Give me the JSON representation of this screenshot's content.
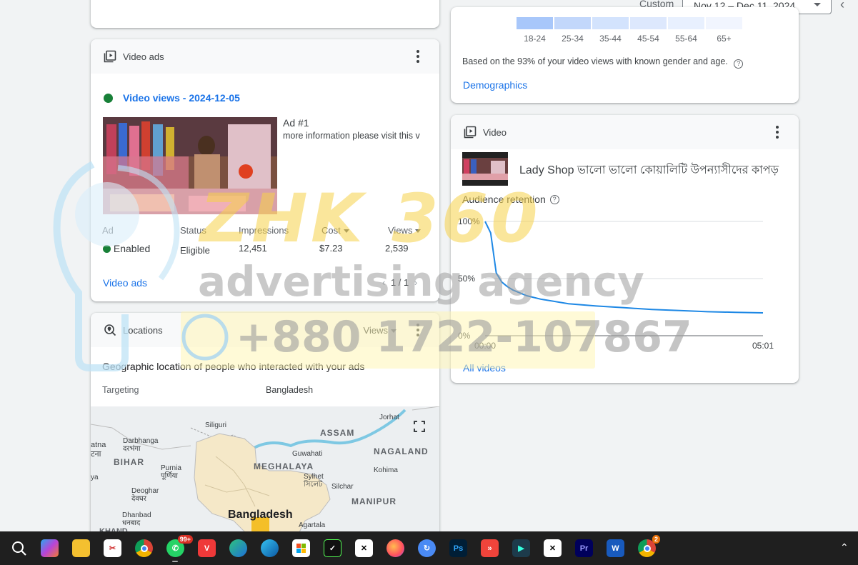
{
  "header": {
    "range_label": "Custom",
    "date_range": "Nov 12 – Dec 11, 2024"
  },
  "demographics": {
    "age_groups": [
      "18-24",
      "25-34",
      "35-44",
      "45-54",
      "55-64",
      "65+"
    ],
    "age_bar_colors": [
      "#a8c7fa",
      "#c2d7fb",
      "#d3e3fd",
      "#dde8fd",
      "#e8f0fe",
      "#f1f5fe"
    ],
    "note": "Based on the 93% of your video views with known gender and age.",
    "link": "Demographics"
  },
  "video_ads": {
    "card_title": "Video ads",
    "campaign": "Video views - 2024-12-05",
    "ad_name": "Ad #1",
    "ad_desc": "more information please visit this v",
    "columns": {
      "ad": "Ad",
      "status": "Status",
      "impressions": "Impressions",
      "cost": "Cost",
      "views": "Views"
    },
    "row": {
      "ad": "Enabled",
      "status": "Eligible",
      "impressions": "12,451",
      "cost": "$7.23",
      "views": "2,539"
    },
    "link": "Video ads",
    "pagination": "1 / 1"
  },
  "locations": {
    "card_title": "Locations",
    "metric": "Views",
    "subtitle": "Geographic location of people who interacted with your ads",
    "targeting_label": "Targeting",
    "targeting_value": "Bangladesh",
    "map_labels": {
      "jorhat": "Jorhat",
      "siliguri": "Siliguri",
      "assam": "ASSAM",
      "darbhanga": "Darbhanga",
      "darbhanga_hi": "दरभंगा",
      "patna": "atna",
      "patna_hi": "टना",
      "bihar": "BIHAR",
      "purnia": "Purnia",
      "purnia_hi": "पूर्णिया",
      "guwahati": "Guwahati",
      "nagaland": "NAGALAND",
      "meghalaya": "MEGHALAYA",
      "kohima": "Kohima",
      "sylhet": "Sylhet",
      "sylhet_bn": "সিলেট",
      "silchar": "Silchar",
      "deoghar": "Deoghar",
      "deoghar_hi": "देवघर",
      "manipur": "MANIPUR",
      "dhanbad": "Dhanbad",
      "dhanbad_hi": "धनबाद",
      "bangladesh": "Bangladesh",
      "agartala": "Agartala",
      "ya": "ya",
      "jharkhand": "KHAND"
    }
  },
  "video": {
    "card_title": "Video",
    "video_title": "Lady Shop ভালো ভালো কোয়ালিটি উপন্যাসীদের কাপড়",
    "retention_label": "Audience retention",
    "link": "All videos"
  },
  "chart_data": {
    "type": "line",
    "title": "Audience retention",
    "x_ticks": [
      "00:00",
      "05:01"
    ],
    "y_ticks": [
      "100%",
      "50%",
      "0%"
    ],
    "ylim": [
      0,
      100
    ],
    "series": [
      {
        "x": [
          0,
          0.02,
          0.04,
          0.06,
          0.08,
          0.1,
          0.15,
          0.2,
          0.3,
          0.4,
          0.5,
          0.6,
          0.7,
          0.8,
          0.9,
          1.0
        ],
        "values": [
          100,
          90,
          55,
          47,
          43,
          40,
          35,
          32,
          28,
          26,
          24.5,
          23,
          22,
          21,
          20.5,
          20
        ]
      }
    ],
    "color": "#1e88e5"
  },
  "watermark": {
    "brand": "ZHK 360",
    "tagline": "advertising agency",
    "phone": "+880 1722-107867"
  },
  "taskbar": {
    "whatsapp_badge": "99+",
    "chrome_badge": "2",
    "icons": [
      "search-icon",
      "copilot-icon",
      "file-explorer-icon",
      "snipping-tool-icon",
      "chrome-icon",
      "whatsapp-icon",
      "vivaldi-icon",
      "edge-dev-icon",
      "edge-icon",
      "ms-store-icon",
      "tasks-icon",
      "capcut-icon",
      "firefox-icon",
      "vpn-icon",
      "photoshop-icon",
      "anydesk-icon",
      "filmora-icon",
      "capcut2-icon",
      "premiere-icon",
      "word-icon",
      "chrome2-icon"
    ]
  }
}
